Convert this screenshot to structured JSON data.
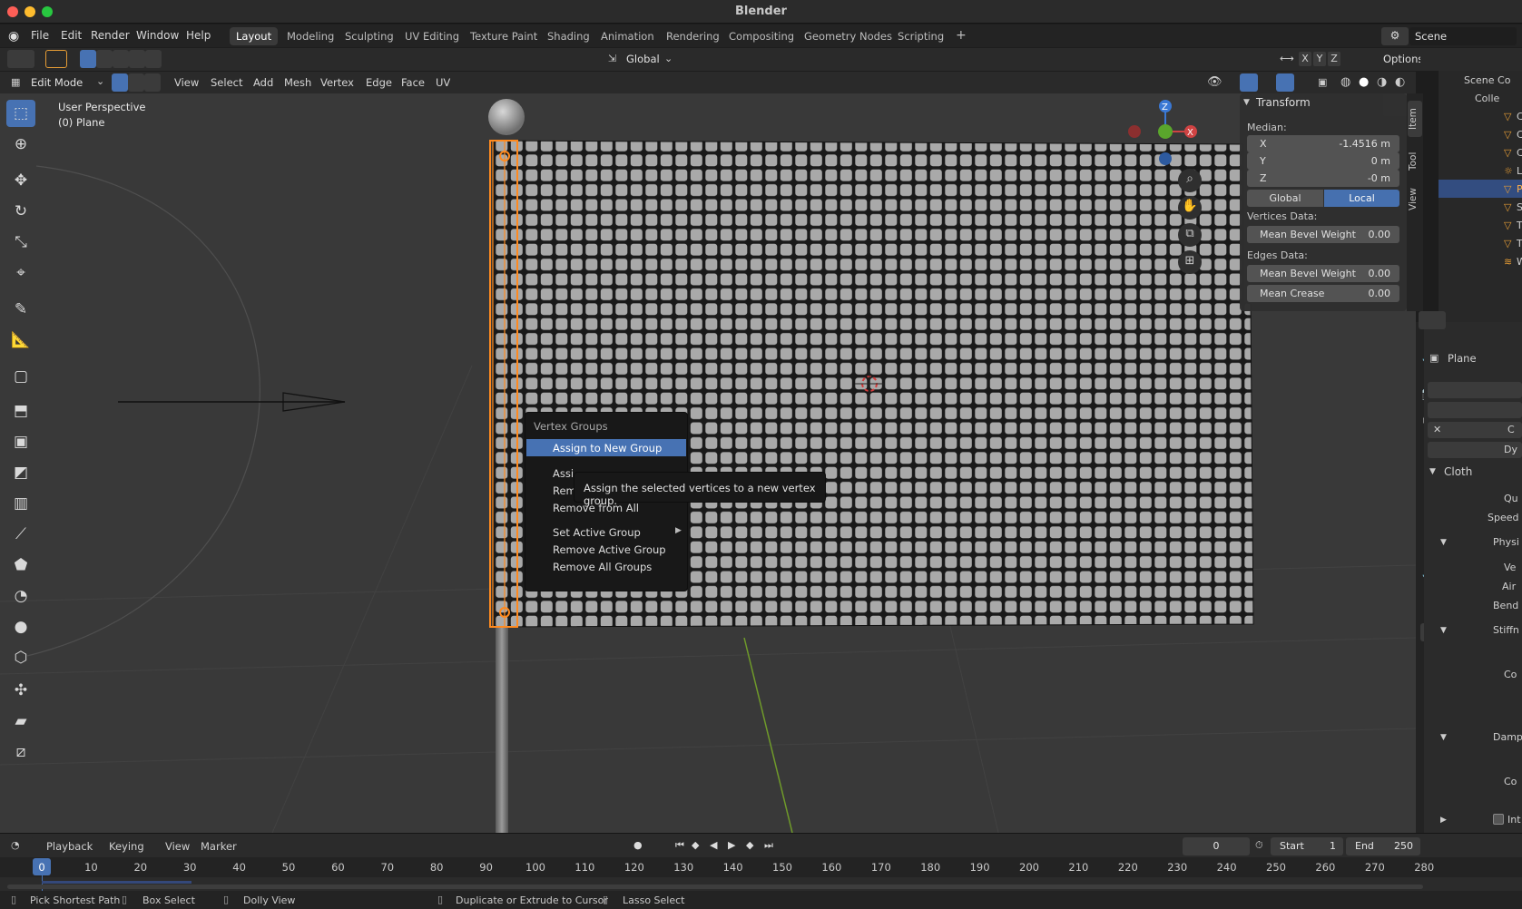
{
  "window": {
    "title": "Blender"
  },
  "menubar": {
    "items": [
      "File",
      "Edit",
      "Render",
      "Window",
      "Help"
    ]
  },
  "workspaces": {
    "tabs": [
      "Layout",
      "Modeling",
      "Sculpting",
      "UV Editing",
      "Texture Paint",
      "Shading",
      "Animation",
      "Rendering",
      "Compositing",
      "Geometry Nodes",
      "Scripting"
    ],
    "active": "Layout",
    "add_symbol": "+"
  },
  "scene": {
    "name": "Scene"
  },
  "tool_header": {
    "orientation": "Global",
    "axes": [
      "X",
      "Y",
      "Z"
    ],
    "options_label": "Options"
  },
  "viewport_header": {
    "mode": "Edit Mode",
    "menus": [
      "View",
      "Select",
      "Add",
      "Mesh",
      "Vertex",
      "Edge",
      "Face",
      "UV"
    ]
  },
  "viewport": {
    "perspective_label": "User Perspective",
    "object_label": "(0) Plane",
    "gizmo_axes": {
      "z": "Z",
      "y": "Y",
      "x": "X"
    },
    "colors": {
      "selected": "#ff8a1f",
      "background": "#393939",
      "active_blue": "#4772b3"
    }
  },
  "toolbar": {
    "icons": [
      "select-box-icon",
      "cursor-icon",
      "move-icon",
      "rotate-icon",
      "scale-icon",
      "transform-icon",
      "annotate-icon",
      "measure-icon",
      "add-cube-icon",
      "extrude-icon",
      "inset-icon",
      "bevel-icon",
      "loop-cut-icon",
      "knife-icon",
      "poly-build-icon",
      "spin-icon",
      "smooth-icon",
      "edge-slide-icon",
      "shrink-fatten-icon",
      "shear-icon",
      "rip-icon"
    ]
  },
  "n_panel": {
    "section": "Transform",
    "median_label": "Median:",
    "coords": [
      {
        "axis": "X",
        "value": "-1.4516 m"
      },
      {
        "axis": "Y",
        "value": "0 m"
      },
      {
        "axis": "Z",
        "value": "-0 m"
      }
    ],
    "space_toggle": {
      "global": "Global",
      "local": "Local",
      "active": "Local"
    },
    "vertices_label": "Vertices Data:",
    "vertex_bevel": {
      "label": "Mean Bevel Weight",
      "value": "0.00"
    },
    "edges_label": "Edges Data:",
    "edge_bevel": {
      "label": "Mean Bevel Weight",
      "value": "0.00"
    },
    "edge_crease": {
      "label": "Mean Crease",
      "value": "0.00"
    },
    "tabs": [
      "Item",
      "Tool",
      "View"
    ]
  },
  "context_menu": {
    "title": "Vertex Groups",
    "items": [
      {
        "label": "Assign to New Group",
        "highlighted": true
      },
      {
        "label": "Assi",
        "highlighted": false
      },
      {
        "label": "Rem",
        "highlighted": false
      },
      {
        "label": "Remove from All",
        "highlighted": false
      },
      {
        "label": "Set Active Group",
        "highlighted": false,
        "submenu": true
      },
      {
        "label": "Remove Active Group",
        "highlighted": false
      },
      {
        "label": "Remove All Groups",
        "highlighted": false
      }
    ],
    "tooltip": "Assign the selected vertices to a new vertex group."
  },
  "outliner": {
    "root": "Scene Co",
    "collection": "Colle",
    "rows": [
      "C",
      "C",
      "C",
      "L",
      "P",
      "S",
      "T",
      "T",
      "W"
    ]
  },
  "properties": {
    "object_name": "Plane",
    "section_cloth": "Cloth",
    "labels": [
      "Qu",
      "Speed",
      "Physi",
      "Ve",
      "Air",
      "Bend",
      "Stiffn",
      "Co",
      "Damp",
      "Co",
      "Int"
    ],
    "row_labels": [
      "C",
      "Dy"
    ]
  },
  "timeline": {
    "menus": [
      "Playback",
      "Keying",
      "View",
      "Marker"
    ],
    "current_frame": "0",
    "start_label": "Start",
    "start_value": "1",
    "end_label": "End",
    "end_value": "250",
    "ruler": [
      "0",
      "10",
      "20",
      "30",
      "40",
      "50",
      "60",
      "70",
      "80",
      "90",
      "100",
      "110",
      "120",
      "130",
      "140",
      "150",
      "160",
      "170",
      "180",
      "190",
      "200",
      "210",
      "220",
      "230",
      "240",
      "250",
      "260",
      "270",
      "280"
    ]
  },
  "statusbar": {
    "items": [
      "Pick Shortest Path",
      "Box Select",
      "Dolly View",
      "Duplicate or Extrude to Cursor",
      "Lasso Select"
    ]
  }
}
